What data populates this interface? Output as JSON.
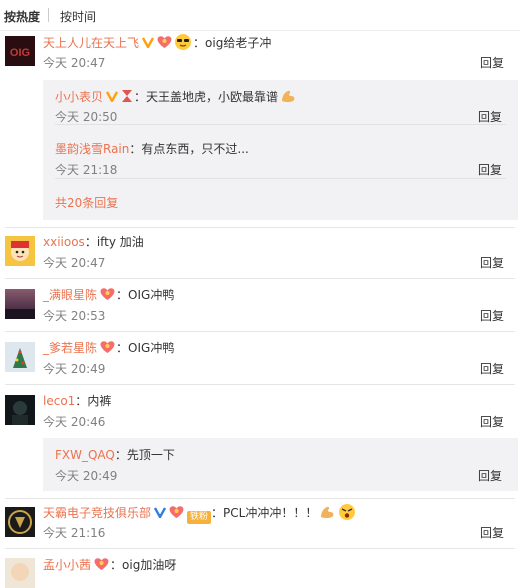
{
  "sort": {
    "hot": "按热度",
    "time": "按时间"
  },
  "comments": [
    {
      "user": "天上人儿在天上飞",
      "text": "oig给老子冲",
      "time": "今天 20:47",
      "reply": "回复",
      "subs": [
        {
          "user": "小小表贝",
          "text": "天王盖地虎，小欧最靠谱",
          "time": "今天 20:50",
          "reply": "回复"
        },
        {
          "user": "墨韵浅雪Rain",
          "text": "有点东西，只不过...",
          "time": "今天 21:18",
          "reply": "回复"
        }
      ],
      "more": "共20条回复"
    },
    {
      "user": "xxiioos",
      "text": "ifty 加油",
      "time": "今天 20:47",
      "reply": "回复"
    },
    {
      "user": "_满眼星陈",
      "text": "OIG冲鸭",
      "time": "今天 20:53",
      "reply": "回复"
    },
    {
      "user": "_爹若星陈",
      "text": "OIG冲鸭",
      "time": "今天 20:49",
      "reply": "回复"
    },
    {
      "user": "leco1",
      "text": "内裤",
      "time": "今天 20:46",
      "reply": "回复",
      "subs": [
        {
          "user": "FXW_QAQ",
          "text": "先顶一下",
          "time": "今天 20:49",
          "reply": "回复"
        }
      ]
    },
    {
      "user": "天霸电子竞技俱乐部",
      "text": "PCL冲冲冲！！！",
      "time": "今天 21:16",
      "reply": "回复",
      "badge": "铁粉"
    },
    {
      "user": "孟小小茜",
      "text": "oig加油呀"
    }
  ],
  "colors": {
    "username": "#eb7350",
    "time": "#808080",
    "subbox": "#f2f2f5",
    "vip": "#ffa00a"
  }
}
